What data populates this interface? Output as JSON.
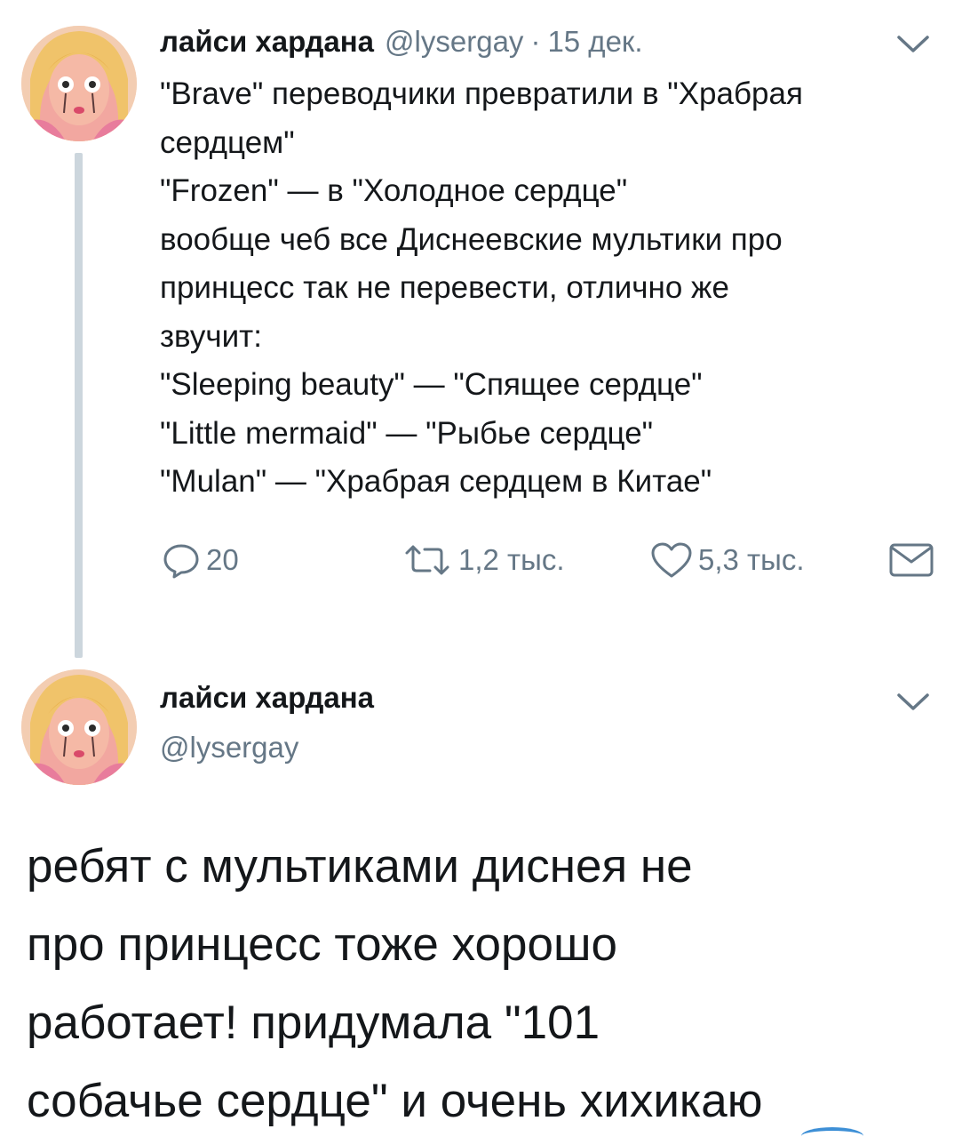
{
  "tweet1": {
    "author_name": "лайси хардана",
    "handle": "@lysergay",
    "separator": "·",
    "date": "15 дек.",
    "lines": [
      "\"Brave\" переводчики превратили в \"Храбрая",
      "сердцем\"",
      "\"Frozen\" — в \"Холодное сердце\"",
      "вообще чеб все Диснеевские мультики про",
      "принцесс так не перевести, отлично же",
      "звучит:",
      "\"Sleeping beauty\" — \"Спящее сердце\"",
      "\"Little mermaid\" — \"Рыбье сердце\"",
      "\"Mulan\" — \"Храбрая сердцем в Китае\""
    ],
    "actions": {
      "reply": {
        "icon": "reply-icon",
        "count": "20"
      },
      "retweet": {
        "icon": "retweet-icon",
        "count": "1,2 тыс."
      },
      "like": {
        "icon": "heart-icon",
        "count": "5,3 тыс."
      },
      "dm": {
        "icon": "envelope-icon"
      }
    }
  },
  "tweet2": {
    "author_name": "лайси хардана",
    "handle": "@lysergay",
    "lines": [
      "ребят с мультиками диснея не",
      "про принцесс тоже хорошо",
      "работает! придумала \"101",
      "собачье сердце\" и очень хихикаю"
    ]
  },
  "colors": {
    "text": "#14171a",
    "secondary": "#657786",
    "thread_line": "#ccd6dd",
    "avatar_bg": "#f7d9c4"
  }
}
